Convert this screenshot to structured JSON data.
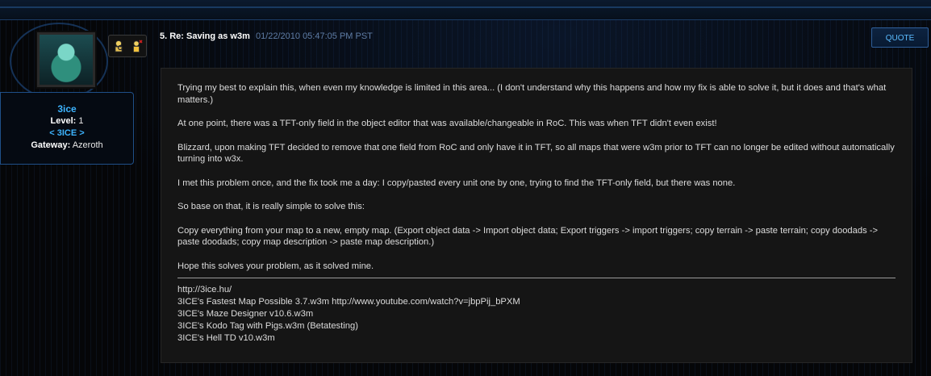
{
  "post": {
    "number_title": "5. Re: Saving as w3m",
    "timestamp": "01/22/2010 05:47:05 PM PST",
    "quote_label": "QUOTE",
    "paragraphs": [
      "Trying my best to explain this, when even my knowledge is limited in this area... (I don't understand why this happens and how my fix is able to solve it, but it does and that's what matters.)",
      "At one point, there was a TFT-only field in the object editor that was available/changeable in RoC. This was when TFT didn't even exist!",
      "Blizzard, upon making TFT decided to remove that one field from RoC and only have it in TFT, so all maps that were w3m prior to TFT can no longer be edited without automatically turning into w3x.",
      "I met this problem once, and the fix took me a day: I copy/pasted every unit one by one, trying to find the TFT-only field, but there was none.",
      "So base on that, it is really simple to solve this:",
      "Copy everything from your map to a new, empty map. (Export object data -> Import object data; Export triggers -> import triggers; copy terrain -> paste terrain; copy doodads -> paste doodads; copy map description -> paste map description.)",
      "Hope this solves your problem, as it solved mine."
    ],
    "signature": [
      "http://3ice.hu/",
      "3ICE's Fastest Map Possible 3.7.w3m http://www.youtube.com/watch?v=jbpPij_bPXM",
      "3ICE's Maze Designer v10.6.w3m",
      "3ICE's Kodo Tag with Pigs.w3m (Betatesting)",
      "3ICE's Hell TD v10.w3m"
    ]
  },
  "user": {
    "name": "3ice",
    "level_label": "Level:",
    "level": "1",
    "clan": "< 3ICE >",
    "gateway_label": "Gateway:",
    "gateway": "Azeroth",
    "icons": [
      "profile-search-icon",
      "add-friend-icon"
    ]
  },
  "colors": {
    "accent": "#3db4ff",
    "timestamp": "#5f7da6",
    "panel": "#151515",
    "border": "#1f4f88"
  }
}
